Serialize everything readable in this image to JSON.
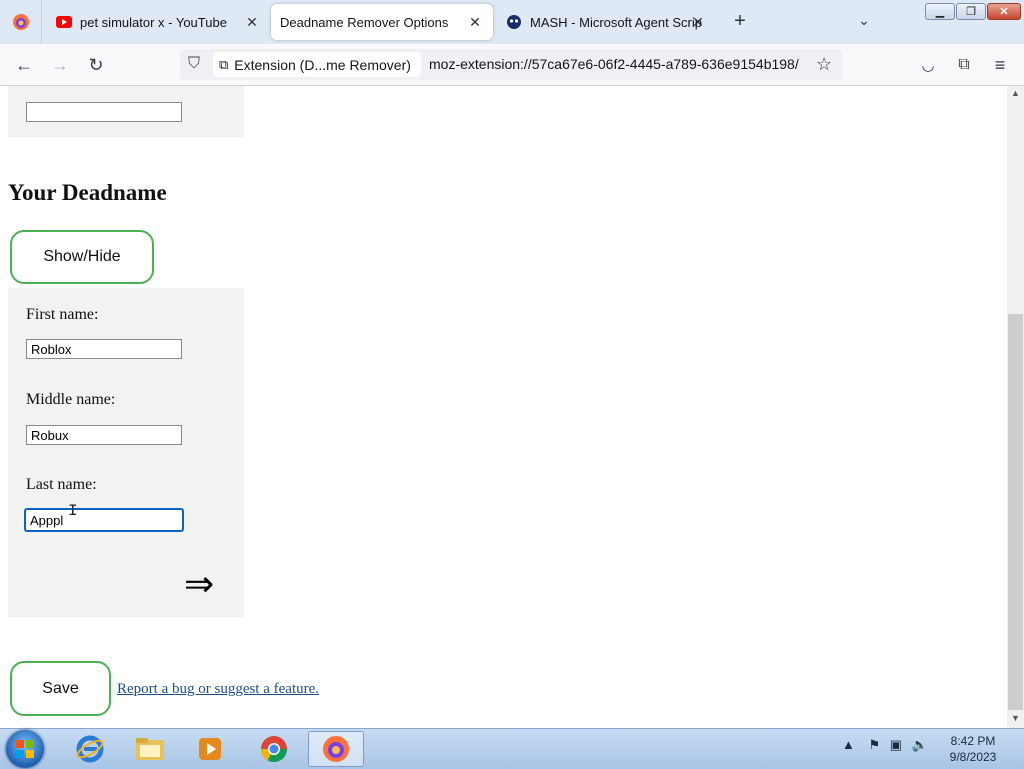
{
  "tabs": [
    {
      "title": "pet simulator x - YouTube",
      "icon": "youtube-icon"
    },
    {
      "title": "Deadname Remover Options",
      "icon": "none",
      "active": true
    },
    {
      "title": "MASH - Microsoft Agent Script",
      "icon": "mash-icon"
    }
  ],
  "navbar": {
    "identity_label": "Extension (D...me Remover)",
    "url": "moz-extension://57ca67e6-06f2-4445-a789-636e9154b198/"
  },
  "page": {
    "top_field_value": "",
    "heading": "Your Deadname",
    "show_hide_label": "Show/Hide",
    "first_name_label": "First name:",
    "first_name_value": "Roblox",
    "middle_name_label": "Middle name:",
    "middle_name_value": "Robux",
    "last_name_label": "Last name:",
    "last_name_value": "Apppl",
    "next_arrow": "⇒",
    "save_label": "Save",
    "report_link": "Report a bug or suggest a feature."
  },
  "taskbar": {
    "time": "8:42 PM",
    "date": "9/8/2023"
  },
  "colors": {
    "accent_green": "#4caf50",
    "link": "#1a4e8a",
    "panel_bg": "#f2f2f2"
  }
}
